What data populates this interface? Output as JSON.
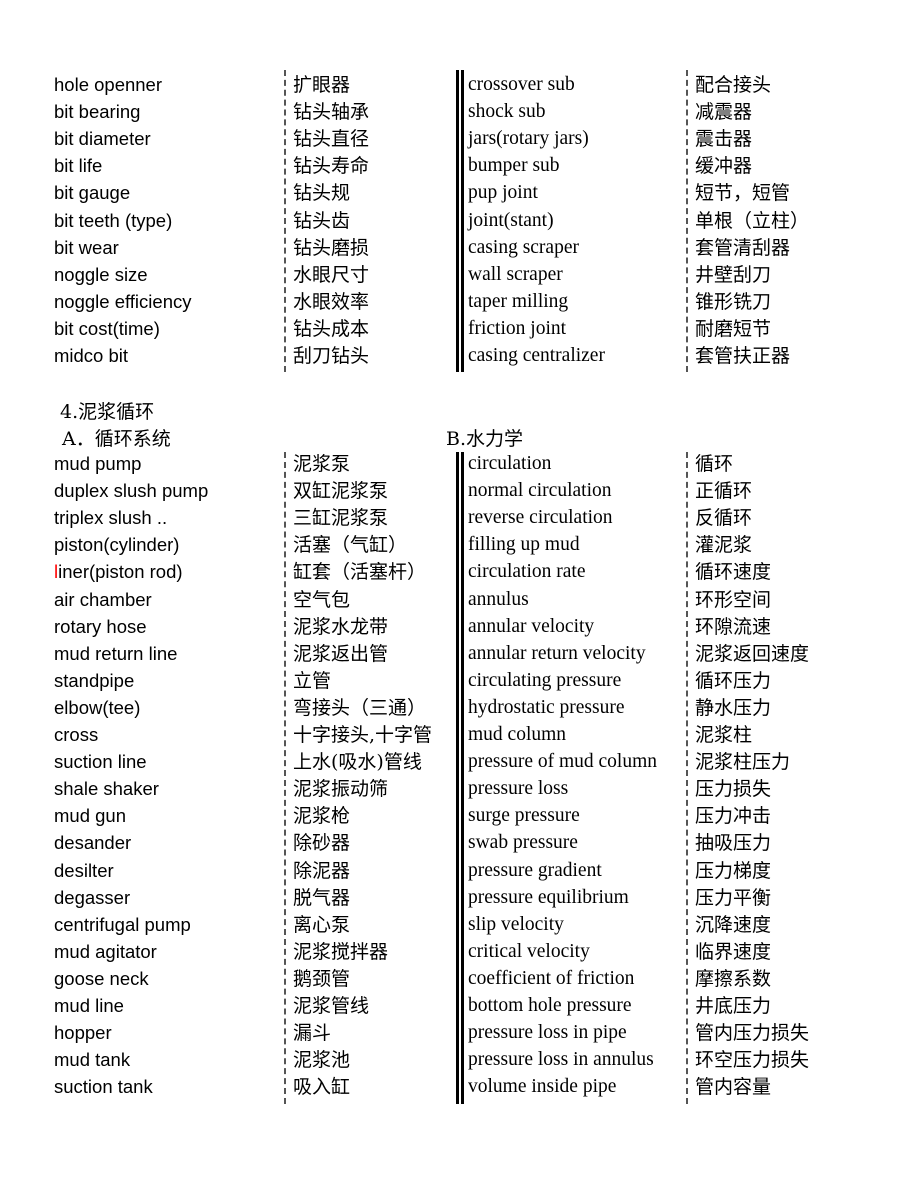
{
  "accent_color": "#ff0000",
  "section1": {
    "rows": [
      [
        "hole openner",
        "扩眼器",
        "crossover sub",
        "配合接头"
      ],
      [
        "bit bearing",
        "钻头轴承",
        "shock sub",
        "减震器"
      ],
      [
        "bit diameter",
        "钻头直径",
        "jars(rotary jars)",
        "震击器"
      ],
      [
        "bit life",
        "钻头寿命",
        "bumper sub",
        "缓冲器"
      ],
      [
        "bit gauge",
        "钻头规",
        "pup joint",
        "短节，短管"
      ],
      [
        "bit teeth (type)",
        "钻头齿",
        "joint(stant)",
        "单根（立柱）"
      ],
      [
        "bit wear",
        "钻头磨损",
        "casing scraper",
        "套管清刮器"
      ],
      [
        "noggle size",
        "水眼尺寸",
        "wall scraper",
        "井壁刮刀"
      ],
      [
        "noggle efficiency",
        "水眼效率",
        "taper milling",
        "锥形铣刀"
      ],
      [
        "bit cost(time)",
        "钻头成本",
        "friction joint",
        "耐磨短节"
      ],
      [
        "midco bit",
        "刮刀钻头",
        "casing centralizer",
        "套管扶正器"
      ]
    ]
  },
  "section2": {
    "title": "4.泥浆循环",
    "subtitle_a": "A．循环系统",
    "subtitle_b": "B.水力学",
    "rows": [
      [
        "mud pump",
        "泥浆泵",
        "circulation",
        "循环"
      ],
      [
        "duplex slush pump",
        "双缸泥浆泵",
        "normal circulation",
        "正循环"
      ],
      [
        "triplex slush ..",
        "三缸泥浆泵",
        "reverse circulation",
        "反循环"
      ],
      [
        "piston(cylinder)",
        "活塞（气缸）",
        "filling up mud",
        "灌泥浆"
      ],
      [
        "liner(piston rod)",
        "缸套（活塞杆）",
        "circulation rate",
        "循环速度"
      ],
      [
        "air chamber",
        "空气包",
        "annulus",
        "环形空间"
      ],
      [
        "rotary hose",
        "泥浆水龙带",
        "annular velocity",
        "环隙流速"
      ],
      [
        "mud return line",
        "泥浆返出管",
        "annular return velocity",
        "泥浆返回速度"
      ],
      [
        "standpipe",
        "立管",
        "circulating pressure",
        "循环压力"
      ],
      [
        "elbow(tee)",
        "弯接头（三通）",
        "hydrostatic pressure",
        "静水压力"
      ],
      [
        "cross",
        "十字接头,十字管",
        "mud column",
        "泥浆柱"
      ],
      [
        "suction line",
        "上水(吸水)管线",
        "pressure of mud column",
        "泥浆柱压力"
      ],
      [
        "shale shaker",
        "泥浆振动筛",
        "pressure loss",
        "压力损失"
      ],
      [
        "mud gun",
        "泥浆枪",
        "surge pressure",
        "压力冲击"
      ],
      [
        "desander",
        "除砂器",
        "swab pressure",
        "抽吸压力"
      ],
      [
        "desilter",
        "除泥器",
        "pressure gradient",
        "压力梯度"
      ],
      [
        "degasser",
        "脱气器",
        "pressure equilibrium",
        "压力平衡"
      ],
      [
        "centrifugal pump",
        "离心泵",
        "slip velocity",
        "沉降速度"
      ],
      [
        "mud agitator",
        "泥浆搅拌器",
        "critical velocity",
        "临界速度"
      ],
      [
        "goose neck",
        "鹅颈管",
        "coefficient of friction",
        "摩擦系数"
      ],
      [
        "mud line",
        "泥浆管线",
        "bottom hole pressure",
        "井底压力"
      ],
      [
        "hopper",
        "漏斗",
        "pressure loss in pipe",
        "管内压力损失"
      ],
      [
        "mud tank",
        "泥浆池",
        "pressure loss in annulus",
        "环空压力损失"
      ],
      [
        "suction tank",
        "吸入缸",
        "volume inside pipe",
        "管内容量"
      ]
    ]
  }
}
